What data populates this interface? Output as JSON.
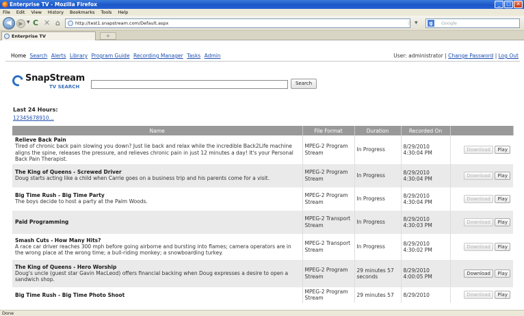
{
  "window": {
    "title": "Enterprise TV - Mozilla Firefox"
  },
  "menu": [
    "File",
    "Edit",
    "View",
    "History",
    "Bookmarks",
    "Tools",
    "Help"
  ],
  "browser": {
    "url": "http://test1.snapstream.com/Default.aspx",
    "search_placeholder": "Google",
    "tab_title": "Enterprise TV",
    "new_tab": "+",
    "status": "Done"
  },
  "nav": {
    "home": "Home",
    "links": [
      "Search",
      "Alerts",
      "Library",
      "Program Guide",
      "Recording Manager",
      "Tasks",
      "Admin"
    ]
  },
  "user": {
    "prefix": "User: administrator |",
    "change_password": "Change Password",
    "sep": "|",
    "logout": "Log Out"
  },
  "logo": {
    "brand": "SnapStream",
    "sub": "TV SEARCH"
  },
  "search": {
    "value": "",
    "button": "Search"
  },
  "section_title": "Last 24 Hours:",
  "pages": [
    "1",
    "2",
    "3",
    "4",
    "5",
    "6",
    "7",
    "8",
    "9",
    "10",
    "..."
  ],
  "table": {
    "headers": [
      "Name",
      "File Format",
      "Duration",
      "Recorded On",
      ""
    ],
    "download_label": "Download",
    "play_label": "Play",
    "rows": [
      {
        "title": "Relieve Back Pain",
        "desc": "Tired of chronic back pain slowing you down? Just lie back and relax while the incredible Back2Life machine aligns the spine, releases the pressure, and relieves chronic pain in just 12 minutes a day! It's your Personal Back Pain Therapist.",
        "format": "MPEG-2 Program Stream",
        "duration": "In Progress",
        "recorded": "8/29/2010 4:30:04 PM",
        "download_enabled": false
      },
      {
        "title": "The King of Queens - Screwed Driver",
        "desc": "Doug starts acting like a child when Carrie goes on a business trip and his parents come for a visit.",
        "format": "MPEG-2 Program Stream",
        "duration": "In Progress",
        "recorded": "8/29/2010 4:30:04 PM",
        "download_enabled": false
      },
      {
        "title": "Big Time Rush - Big Time Party",
        "desc": "The boys decide to host a party at the Palm Woods.",
        "format": "MPEG-2 Program Stream",
        "duration": "In Progress",
        "recorded": "8/29/2010 4:30:04 PM",
        "download_enabled": false
      },
      {
        "title": "Paid Programming",
        "desc": "",
        "format": "MPEG-2 Transport Stream",
        "duration": "In Progress",
        "recorded": "8/29/2010 4:30:03 PM",
        "download_enabled": false
      },
      {
        "title": "Smash Cuts - How Many Hits?",
        "desc": "A race car driver reaches 300 mph before going airborne and bursting into flames; camera operators are in the wrong place at the wrong time; a bull-riding monkey; a snowboarding turkey.",
        "format": "MPEG-2 Transport Stream",
        "duration": "In Progress",
        "recorded": "8/29/2010 4:30:02 PM",
        "download_enabled": false
      },
      {
        "title": "The King of Queens - Hero Worship",
        "desc": "Doug's uncle (guest star Gavin MacLeod) offers financial backing when Doug expresses a desire to open a sandwich shop.",
        "format": "MPEG-2 Program Stream",
        "duration": "29 minutes 57 seconds",
        "recorded": "8/29/2010 4:00:05 PM",
        "download_enabled": true
      },
      {
        "title": "Big Time Rush - Big Time Photo Shoot",
        "desc": "",
        "format": "MPEG-2 Program Stream",
        "duration": "29 minutes 57",
        "recorded": "8/29/2010",
        "download_enabled": false
      }
    ]
  }
}
